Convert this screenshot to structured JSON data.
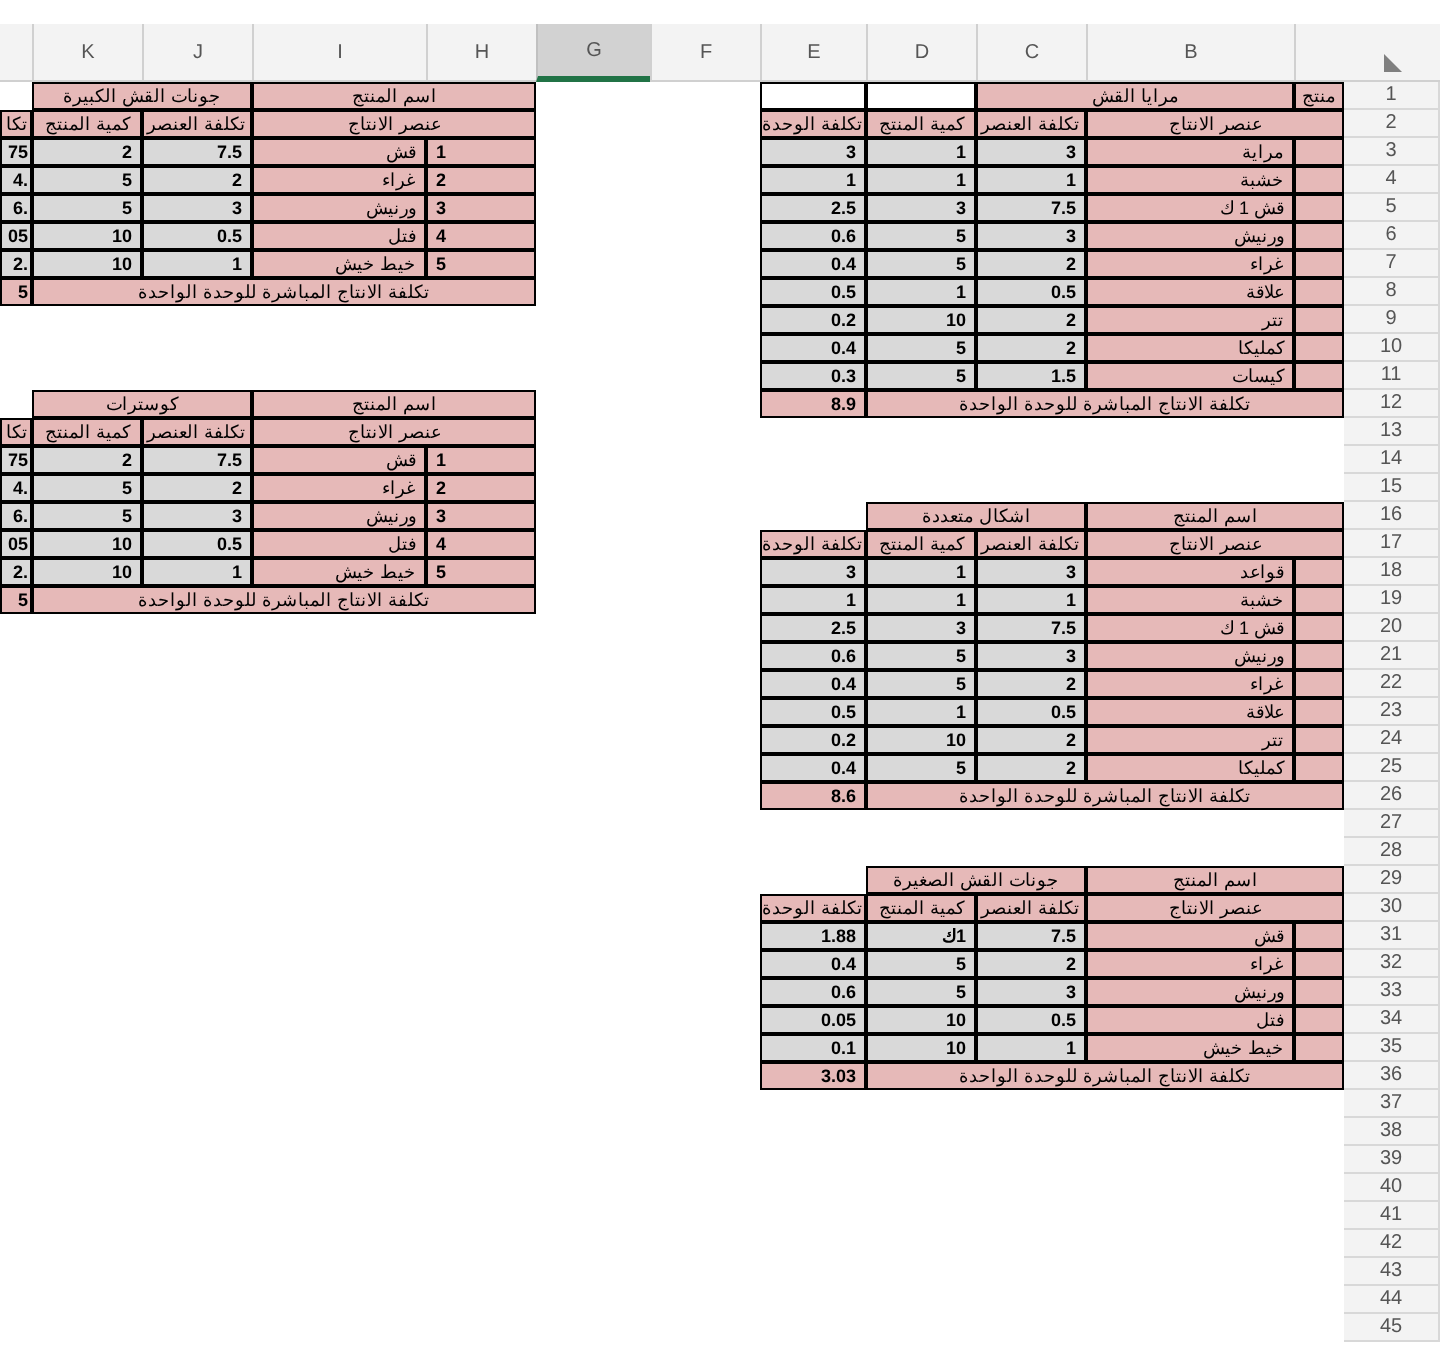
{
  "column_headers": [
    {
      "label": "B",
      "selected": false
    },
    {
      "label": "C",
      "selected": false
    },
    {
      "label": "D",
      "selected": false
    },
    {
      "label": "E",
      "selected": false
    },
    {
      "label": "F",
      "selected": false
    },
    {
      "label": "G",
      "selected": true
    },
    {
      "label": "H",
      "selected": false
    },
    {
      "label": "I",
      "selected": false
    },
    {
      "label": "J",
      "selected": false
    },
    {
      "label": "K",
      "selected": false
    }
  ],
  "row_headers": [
    "1",
    "2",
    "3",
    "4",
    "5",
    "6",
    "7",
    "8",
    "9",
    "10",
    "11",
    "12",
    "13",
    "14",
    "15",
    "16",
    "17",
    "18",
    "19",
    "20",
    "21",
    "22",
    "23",
    "24",
    "25",
    "26",
    "27",
    "28",
    "29",
    "30",
    "31",
    "32",
    "33",
    "34",
    "35",
    "36",
    "37",
    "38",
    "39",
    "40",
    "41",
    "42",
    "43",
    "44",
    "45"
  ],
  "tables": [
    {
      "label": "منتج",
      "product": "مرايا القش",
      "columns": {
        "element": "عنصر الانتاج",
        "cost": "تكلفة العنصر",
        "qty": "كمية المنتج",
        "unit": "تكلفة الوحدة"
      },
      "items": [
        {
          "name": "مراية",
          "cost": "3",
          "qty": "1",
          "unit": "3"
        },
        {
          "name": "خشبة",
          "cost": "1",
          "qty": "1",
          "unit": "1"
        },
        {
          "name": "قش 1 ك",
          "cost": "7.5",
          "qty": "3",
          "unit": "2.5"
        },
        {
          "name": "ورنيش",
          "cost": "3",
          "qty": "5",
          "unit": "0.6"
        },
        {
          "name": "غراء",
          "cost": "2",
          "qty": "5",
          "unit": "0.4"
        },
        {
          "name": "علاقة",
          "cost": "0.5",
          "qty": "1",
          "unit": "0.5"
        },
        {
          "name": "تتر",
          "cost": "2",
          "qty": "10",
          "unit": "0.2"
        },
        {
          "name": "كمليكا",
          "cost": "2",
          "qty": "5",
          "unit": "0.4"
        },
        {
          "name": "كيسات",
          "cost": "1.5",
          "qty": "5",
          "unit": "0.3"
        }
      ],
      "total_label": "تكلفة الانتاج المباشرة للوحدة الواحدة",
      "total": "8.9"
    },
    {
      "label": "اسم المنتج",
      "product": "جونات القش الكبيرة",
      "columns": {
        "element": "عنصر الانتاج",
        "cost": "تكلفة العنصر",
        "qty": "كمية المنتج",
        "unit": "تكا"
      },
      "items": [
        {
          "number": "1",
          "name": "قش",
          "cost": "7.5",
          "qty": "2",
          "unit": "75"
        },
        {
          "number": "2",
          "name": "غراء",
          "cost": "2",
          "qty": "5",
          "unit": ".4"
        },
        {
          "number": "3",
          "name": "ورنيش",
          "cost": "3",
          "qty": "5",
          "unit": ".6"
        },
        {
          "number": "4",
          "name": "فتل",
          "cost": "0.5",
          "qty": "10",
          "unit": "05"
        },
        {
          "number": "5",
          "name": "خيط خيش",
          "cost": "1",
          "qty": "10",
          "unit": ".2"
        }
      ],
      "total_label": "تكلفة الانتاج المباشرة للوحدة الواحدة",
      "total": "5"
    },
    {
      "label": "اسم المنتج",
      "product": "كوسترات",
      "columns": {
        "element": "عنصر الانتاج",
        "cost": "تكلفة العنصر",
        "qty": "كمية المنتج",
        "unit": "تكا"
      },
      "items": [
        {
          "number": "1",
          "name": "قش",
          "cost": "7.5",
          "qty": "2",
          "unit": "75"
        },
        {
          "number": "2",
          "name": "غراء",
          "cost": "2",
          "qty": "5",
          "unit": ".4"
        },
        {
          "number": "3",
          "name": "ورنيش",
          "cost": "3",
          "qty": "5",
          "unit": ".6"
        },
        {
          "number": "4",
          "name": "فتل",
          "cost": "0.5",
          "qty": "10",
          "unit": "05"
        },
        {
          "number": "5",
          "name": "خيط خيش",
          "cost": "1",
          "qty": "10",
          "unit": ".2"
        }
      ],
      "total_label": "تكلفة الانتاج المباشرة للوحدة الواحدة",
      "total": "5"
    },
    {
      "label": "اسم المنتج",
      "product": "اشكال متعددة",
      "columns": {
        "element": "عنصر الانتاج",
        "cost": "تكلفة العنصر",
        "qty": "كمية المنتج",
        "unit": "تكلفة الوحدة"
      },
      "items": [
        {
          "name": "قواعد",
          "cost": "3",
          "qty": "1",
          "unit": "3"
        },
        {
          "name": "خشبة",
          "cost": "1",
          "qty": "1",
          "unit": "1"
        },
        {
          "name": "قش 1 ك",
          "cost": "7.5",
          "qty": "3",
          "unit": "2.5"
        },
        {
          "name": "ورنيش",
          "cost": "3",
          "qty": "5",
          "unit": "0.6"
        },
        {
          "name": "غراء",
          "cost": "2",
          "qty": "5",
          "unit": "0.4"
        },
        {
          "name": "علاقة",
          "cost": "0.5",
          "qty": "1",
          "unit": "0.5"
        },
        {
          "name": "تتر",
          "cost": "2",
          "qty": "10",
          "unit": "0.2"
        },
        {
          "name": "كمليكا",
          "cost": "2",
          "qty": "5",
          "unit": "0.4"
        }
      ],
      "total_label": "تكلفة الانتاج المباشرة للوحدة الواحدة",
      "total": "8.6"
    },
    {
      "label": "اسم المنتج",
      "product": "جونات القش الصغيرة",
      "columns": {
        "element": "عنصر الانتاج",
        "cost": "تكلفة العنصر",
        "qty": "كمية المنتج",
        "unit": "تكلفة الوحدة"
      },
      "items": [
        {
          "name": "قش",
          "cost": "7.5",
          "qty": "1ك",
          "unit": "1.88"
        },
        {
          "name": "غراء",
          "cost": "2",
          "qty": "5",
          "unit": "0.4"
        },
        {
          "name": "ورنيش",
          "cost": "3",
          "qty": "5",
          "unit": "0.6"
        },
        {
          "name": "فتل",
          "cost": "0.5",
          "qty": "10",
          "unit": "0.05"
        },
        {
          "name": "خيط خيش",
          "cost": "1",
          "qty": "10",
          "unit": "0.1"
        }
      ],
      "total_label": "تكلفة الانتاج المباشرة للوحدة الواحدة",
      "total": "3.03"
    }
  ]
}
